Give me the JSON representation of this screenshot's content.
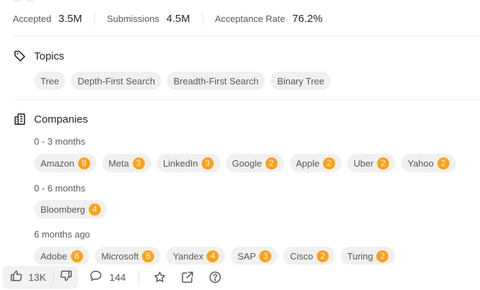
{
  "stats": {
    "accepted_label": "Accepted",
    "accepted_value": "3.5M",
    "submissions_label": "Submissions",
    "submissions_value": "4.5M",
    "acceptance_label": "Acceptance Rate",
    "acceptance_value": "76.2%"
  },
  "topics": {
    "title": "Topics",
    "icon": "tag-icon",
    "items": [
      "Tree",
      "Depth-First Search",
      "Breadth-First Search",
      "Binary Tree"
    ]
  },
  "companies": {
    "title": "Companies",
    "icon": "building-icon",
    "groups": [
      {
        "period": "0 - 3 months",
        "items": [
          {
            "name": "Amazon",
            "count": "9"
          },
          {
            "name": "Meta",
            "count": "3"
          },
          {
            "name": "LinkedIn",
            "count": "3"
          },
          {
            "name": "Google",
            "count": "2"
          },
          {
            "name": "Apple",
            "count": "2"
          },
          {
            "name": "Uber",
            "count": "2"
          },
          {
            "name": "Yahoo",
            "count": "2"
          }
        ]
      },
      {
        "period": "0 - 6 months",
        "items": [
          {
            "name": "Bloomberg",
            "count": "4"
          }
        ]
      },
      {
        "period": "6 months ago",
        "items": [
          {
            "name": "Adobe",
            "count": "8"
          },
          {
            "name": "Microsoft",
            "count": "6"
          },
          {
            "name": "Yandex",
            "count": "4"
          },
          {
            "name": "SAP",
            "count": "3"
          },
          {
            "name": "Cisco",
            "count": "2"
          },
          {
            "name": "Turing",
            "count": "2"
          }
        ]
      }
    ]
  },
  "bottom_bar": {
    "likes": "13K",
    "comments": "144",
    "icons": [
      "thumbs-up-icon",
      "thumbs-down-icon",
      "comment-icon",
      "star-icon",
      "share-icon",
      "help-icon"
    ]
  },
  "colors": {
    "badge": "#ffa116",
    "chip_bg": "#f0f0f0",
    "text_primary": "#262626",
    "text_secondary": "#595959"
  }
}
